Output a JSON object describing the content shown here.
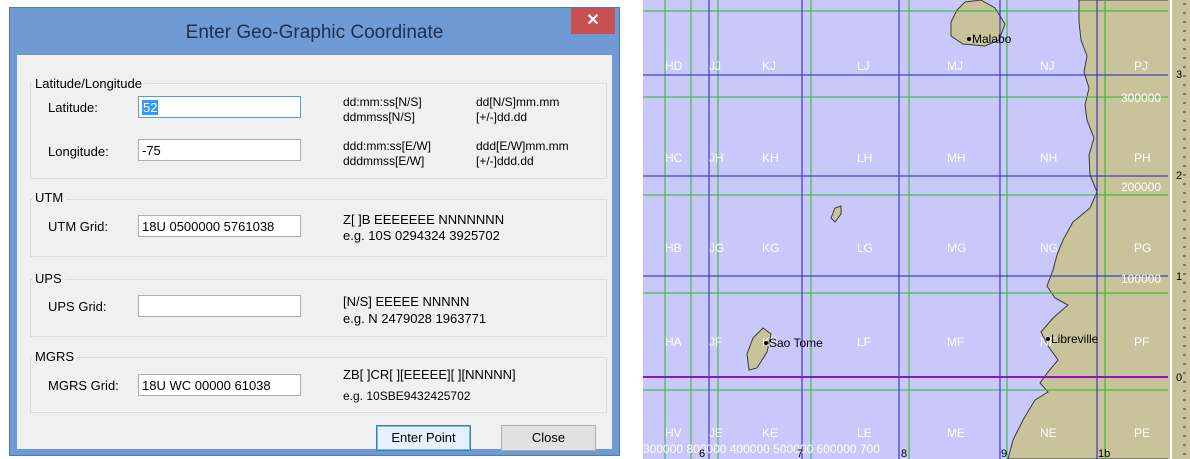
{
  "dialog": {
    "title": "Enter Geo-Graphic Coordinate",
    "close_glyph": "✕",
    "latlon": {
      "group_label": "Latitude/Longitude",
      "latitude_label": "Latitude:",
      "latitude_value": "52",
      "longitude_label": "Longitude:",
      "longitude_value": "-75",
      "lat_fmt_1": "dd:mm:ss[N/S]\nddmmss[N/S]",
      "lat_fmt_2": "dd[N/S]mm.mm\n[+/-]dd.dd",
      "lon_fmt_1": "ddd:mm:ss[E/W]\ndddmmss[E/W]",
      "lon_fmt_2": "ddd[E/W]mm.mm\n[+/-]ddd.dd"
    },
    "utm": {
      "group_label": "UTM",
      "label": "UTM Grid:",
      "value": "18U 0500000 5761038",
      "hint": "Z[ ]B EEEEEEE NNNNNNN\ne.g. 10S 0294324 3925702"
    },
    "ups": {
      "group_label": "UPS",
      "label": "UPS Grid:",
      "value": "",
      "hint": "[N/S] EEEEE NNNNN\ne.g. N 2479028 1963771"
    },
    "mgrs": {
      "group_label": "MGRS",
      "label": "MGRS Grid:",
      "value": "18U WC 00000 61038",
      "hint_1": "ZB[ ]CR[ ][EEEEE][ ][NNNNN]",
      "hint_2": "e.g. 10SBE9432425702"
    },
    "buttons": {
      "enter_point": "Enter Point",
      "close": "Close"
    }
  },
  "map": {
    "cities": {
      "malabo": "Malabo",
      "sao_tome": "Sao Tome",
      "libreville": "Libreville"
    },
    "zones": {
      "row_HD": [
        "HD",
        "JJ",
        "KJ",
        "LJ",
        "MJ",
        "NJ",
        "PJ"
      ],
      "row_HC": [
        "HC",
        "JH",
        "KH",
        "LH",
        "MH",
        "NH",
        "PH"
      ],
      "row_HB": [
        "HB",
        "JG",
        "KG",
        "LG",
        "MG",
        "NG",
        "PG"
      ],
      "row_HA": [
        "HA",
        "JF",
        "KF",
        "LF",
        "MF",
        "NF",
        "PF"
      ],
      "row_HV": [
        "HV",
        "JE",
        "KE",
        "LE",
        "ME",
        "NE",
        "PE"
      ]
    },
    "northings": [
      "300000",
      "200000",
      "100000"
    ],
    "ruler_digits": [
      "3",
      "2",
      "1",
      "0"
    ],
    "bottom_numbers": [
      "6",
      "7",
      "8",
      "9",
      "1b"
    ],
    "bottom_eastings": "300000  800000  400000  500000  600000  700",
    "colors": {
      "water": "#c8c8fb",
      "land": "#c8c39a",
      "grid_green": "#22bb22",
      "grid_blue": "#2020c0",
      "equator": "#8a1ab8"
    }
  }
}
